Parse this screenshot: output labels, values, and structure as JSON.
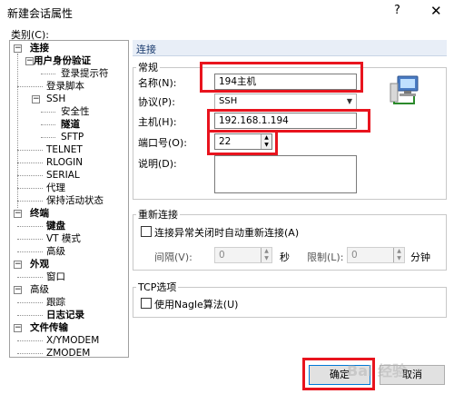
{
  "window": {
    "title": "新建会话属性",
    "help": "?",
    "close": "✕"
  },
  "category_label": "类别(C):",
  "tree": {
    "connection": "连接",
    "auth": "用户身份验证",
    "login_prompt": "登录提示符",
    "login_script": "登录脚本",
    "ssh": "SSH",
    "security": "安全性",
    "tunnel": "隧道",
    "sftp": "SFTP",
    "telnet": "TELNET",
    "rlogin": "RLOGIN",
    "serial": "SERIAL",
    "proxy": "代理",
    "keepalive": "保持活动状态",
    "terminal": "终端",
    "keyboard": "键盘",
    "vt_mode": "VT 模式",
    "advanced": "高级",
    "appearance": "外观",
    "window": "窗口",
    "advanced2": "高级",
    "trace": "跟踪",
    "log": "日志记录",
    "file_transfer": "文件传输",
    "xymodem": "X/YMODEM",
    "zmodem": "ZMODEM"
  },
  "section_header": "连接",
  "general": {
    "group_label": "常规",
    "name_label": "名称(N):",
    "name_value": "194主机",
    "protocol_label": "协议(P):",
    "protocol_value": "SSH",
    "host_label": "主机(H):",
    "host_value": "192.168.1.194",
    "port_label": "端口号(O):",
    "port_value": "22",
    "desc_label": "说明(D):",
    "desc_value": ""
  },
  "reconnect": {
    "group_label": "重新连接",
    "auto_label": "连接异常关闭时自动重新连接(A)",
    "interval_label": "间隔(V):",
    "interval_value": "0",
    "seconds": "秒",
    "limit_label": "限制(L):",
    "limit_value": "0",
    "minutes": "分钟"
  },
  "tcp": {
    "group_label": "TCP选项",
    "nagle_label": "使用Nagle算法(U)"
  },
  "buttons": {
    "ok": "确定",
    "cancel": "取消"
  },
  "watermark": "Bai 经验",
  "colors": {
    "highlight": "#e8141e",
    "header_bg": "#e8eef7",
    "header_text": "#1a3b6e"
  }
}
